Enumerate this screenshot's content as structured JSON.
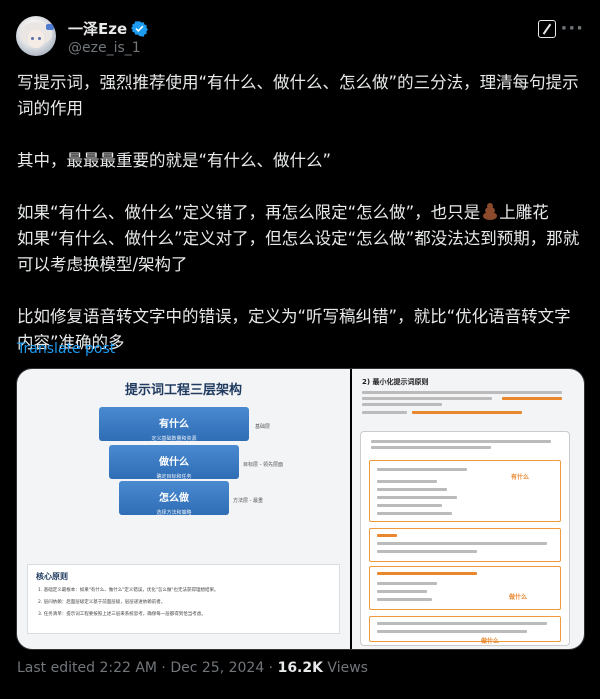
{
  "author": {
    "name": "一泽Eze",
    "handle": "@eze_is_1",
    "verified_color": "#1d9bf0"
  },
  "header": {
    "grok_icon": "grok-icon",
    "more_icon": "more-icon",
    "more_label": "···"
  },
  "post": {
    "lines": [
      "写提示词，强烈推荐使用“有什么、做什么、怎么做”的三分法，理清每句提示词的作用",
      "其中，最最最重要的就是“有什么、做什么”",
      "如果“有什么、做什么”定义错了，再怎么限定“怎么做”，也只是",
      "上雕花",
      "如果“有什么、做什么”定义对了，但怎么设定“怎么做”都没法达到预期，那就可以考虑换模型/架构了",
      "比如修复语音转文字中的错误，定义为“听写稿纠错”，就比“优化语音转文字内容”准确的多"
    ],
    "emoji": "poop-emoji",
    "translate": "Translate post"
  },
  "image1": {
    "title": "提示词工程三层架构",
    "tiers": [
      {
        "label": "有什么",
        "sub": "定义基础数量和资源"
      },
      {
        "label": "做什么",
        "sub": "确定目标和任务"
      },
      {
        "label": "怎么做",
        "sub": "选择方法和策略"
      }
    ],
    "side_notes": [
      "基础层",
      "目标层 - 领先层面",
      "方法层 - 最重"
    ],
    "core_title": "核心原则",
    "core_lines": [
      "1. 基础定义最根本：如果\"有什么、做什么\"定义错误，优化\"怎么做\"也无法获得理想结果。",
      "2. 层间依赖：后面层级定义基于前面层级，层层递进依赖前者。",
      "3. 任务清单：提示词工程要按照上述三层来系统思考，确保每一层都得到恰当考虑。"
    ]
  },
  "image2": {
    "heading": "2) 最小化提示词原则",
    "tags": [
      "有什么",
      "做什么",
      "做什么"
    ]
  },
  "footer": {
    "edited": "Last edited 2:22 AM · Dec 25, 2024 · ",
    "views_count": "16.2K",
    "views_label": " Views"
  }
}
